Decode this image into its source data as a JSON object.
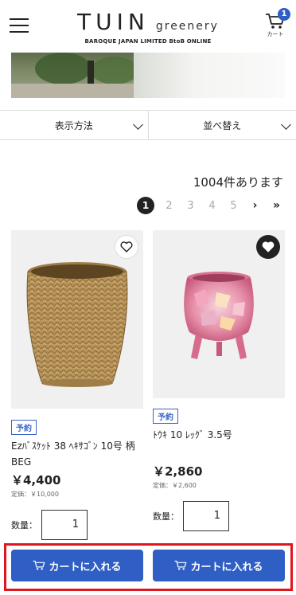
{
  "header": {
    "logo_main": "TUIN",
    "logo_sub_word": "greenery",
    "logo_tagline": "BAROQUE JAPAN LIMITED BtoB ONLINE",
    "cart_count": "1",
    "cart_label": "カート"
  },
  "filters": {
    "display_label": "表示方法",
    "sort_label": "並べ替え"
  },
  "results": {
    "count_text": "1004件あります"
  },
  "pagination": {
    "pages": [
      "1",
      "2",
      "3",
      "4",
      "5"
    ],
    "next": "›",
    "last": "»"
  },
  "products": [
    {
      "badge": "予約",
      "name": "Ezﾊﾞｽｹｯﾄ 38 ﾍｷｻｺﾞﾝ 10号 柄BEG",
      "price": "￥4,400",
      "list_price": "定価：￥10,000",
      "qty_label": "数量：",
      "qty": "1",
      "add_to_cart": "カートに入れる",
      "favorited": false
    },
    {
      "badge": "予約",
      "name": "ﾄｳｷ 10 ﾚｯｸﾞ 3.5号",
      "price": "￥2,860",
      "list_price": "定価：￥2,600",
      "qty_label": "数量：",
      "qty": "1",
      "add_to_cart": "カートに入れる",
      "favorited": true
    }
  ],
  "colors": {
    "accent": "#2f5ec4",
    "highlight": "#e0161f"
  }
}
